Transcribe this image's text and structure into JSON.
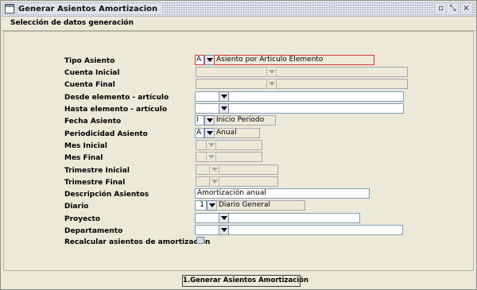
{
  "window": {
    "title": "Generar Asientos Amortizacion",
    "controls": {
      "restore": "▫",
      "minimize": "⤡",
      "close": "×"
    }
  },
  "section_label": "Selección de datos generación",
  "form": {
    "tipo_asiento": {
      "label": "Tipo Asiento",
      "code": "A",
      "description": "Asiento por Articulo Elemento"
    },
    "cuenta_inicial": {
      "label": "Cuenta Inicial"
    },
    "cuenta_final": {
      "label": "Cuenta Final"
    },
    "desde_elemento": {
      "label": "Desde elemento - artículo"
    },
    "hasta_elemento": {
      "label": "Hasta elemento - artículo"
    },
    "fecha_asiento": {
      "label": "Fecha Asiento",
      "code": "I",
      "description": "Inicio Periodo"
    },
    "periodicidad": {
      "label": "Periodicidad Asiento",
      "code": "A",
      "description": "Anual"
    },
    "mes_inicial": {
      "label": "Mes Inicial"
    },
    "mes_final": {
      "label": "Mes Final"
    },
    "trimestre_inicial": {
      "label": "Trimestre Inicial"
    },
    "trimestre_final": {
      "label": "Trimestre Final"
    },
    "descripcion": {
      "label": "Descripción Asientos",
      "value": "Amortización anual"
    },
    "diario": {
      "label": "Diario",
      "code": "1",
      "description": "Diario General"
    },
    "proyecto": {
      "label": "Proyecto"
    },
    "departamento": {
      "label": "Departamento"
    },
    "recalcular": {
      "label": "Recalcular asientos de amortización",
      "checked": false
    }
  },
  "footer": {
    "generate_button": "1.Generar Asientos Amortización"
  },
  "colors": {
    "background": "#ece9d8",
    "error_border": "#d13b3b",
    "field_border": "#7f9db9"
  }
}
